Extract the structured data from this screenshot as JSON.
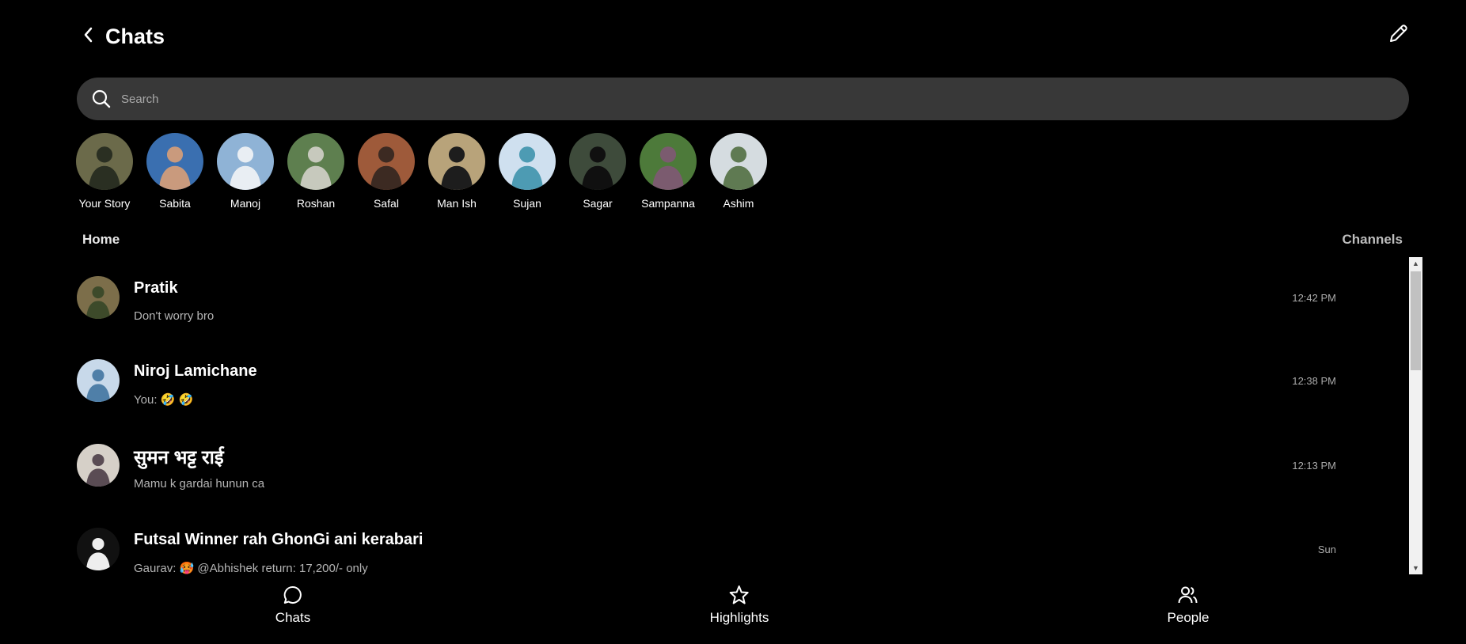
{
  "header": {
    "title": "Chats",
    "back_icon": "chevron-left-icon",
    "compose_icon": "pencil-icon"
  },
  "search": {
    "placeholder": "Search",
    "value": "",
    "icon": "search-icon"
  },
  "stories": [
    {
      "name": "Your Story",
      "colors": [
        "#6b6a4a",
        "#2a2f22"
      ]
    },
    {
      "name": "Sabita",
      "colors": [
        "#3a6fb0",
        "#c99a7d"
      ]
    },
    {
      "name": "Manoj",
      "colors": [
        "#8fb3d6",
        "#e9eef3"
      ]
    },
    {
      "name": "Roshan",
      "colors": [
        "#5e7f4f",
        "#c7c9bd"
      ]
    },
    {
      "name": "Safal",
      "colors": [
        "#9e5a3a",
        "#3c2a22"
      ]
    },
    {
      "name": "Man Ish",
      "colors": [
        "#b8a37a",
        "#1d1d1d"
      ]
    },
    {
      "name": "Sujan",
      "colors": [
        "#cfe0ef",
        "#4d9bb3"
      ]
    },
    {
      "name": "Sagar",
      "colors": [
        "#3e4b3b",
        "#101010"
      ]
    },
    {
      "name": "Sampanna",
      "colors": [
        "#4d7a3a",
        "#7b5b6f"
      ]
    },
    {
      "name": "Ashim",
      "colors": [
        "#d5dce0",
        "#5f7a52"
      ]
    }
  ],
  "sections": {
    "home": "Home",
    "channels": "Channels"
  },
  "chats": [
    {
      "name": "Pratik",
      "preview": "Don't worry bro",
      "time": "12:42 PM",
      "colors": [
        "#7c6e4a",
        "#3d4a2a"
      ]
    },
    {
      "name": "Niroj Lamichane",
      "preview": "You: 🤣 🤣",
      "time": "12:38 PM",
      "colors": [
        "#c8d9ea",
        "#4f7fa8"
      ]
    },
    {
      "name": "सुमन भट्ट राई",
      "preview": "Mamu k gardai hunun ca",
      "time": "12:13 PM",
      "colors": [
        "#d6d0c8",
        "#5a4c54"
      ]
    },
    {
      "name": "Futsal Winner rah GhonGi ani kerabari",
      "preview": "Gaurav: 🥵 @Abhishek return: 17,200/- only",
      "time": "Sun",
      "colors": [
        "#111111",
        "#eeeeee"
      ]
    }
  ],
  "bottom_nav": [
    {
      "label": "Chats",
      "icon": "chat-bubble-icon"
    },
    {
      "label": "Highlights",
      "icon": "star-icon"
    },
    {
      "label": "People",
      "icon": "people-icon"
    }
  ]
}
